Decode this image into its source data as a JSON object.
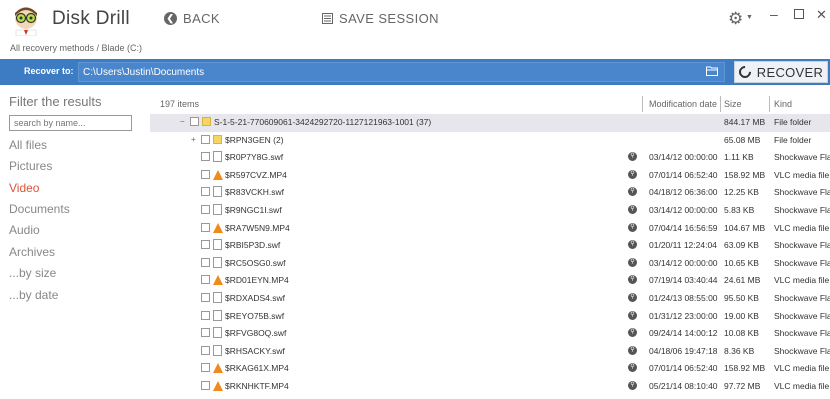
{
  "app": {
    "title": "Disk Drill",
    "back_label": "BACK",
    "save_label": "SAVE SESSION",
    "breadcrumb": "All recovery methods / Blade (C:)"
  },
  "recover": {
    "label": "Recover to:",
    "path": "C:\\Users\\Justin\\Documents",
    "button_label": "RECOVER"
  },
  "sidebar": {
    "title": "Filter the results",
    "search_placeholder": "search by name...",
    "items": [
      {
        "label": "All files"
      },
      {
        "label": "Pictures"
      },
      {
        "label": "Video"
      },
      {
        "label": "Documents"
      },
      {
        "label": "Audio"
      },
      {
        "label": "Archives"
      },
      {
        "label": "...by size"
      },
      {
        "label": "...by date"
      }
    ],
    "active_item": "Video"
  },
  "table": {
    "items_count": "197 items",
    "columns": {
      "date": "Modification date",
      "size": "Size",
      "kind": "Kind"
    },
    "rows": [
      {
        "name": "S-1-5-21-770609061-3424292720-1127121963-1001 (37)",
        "date": "",
        "size": "844.17 MB",
        "kind": "File folder",
        "type": "folder",
        "level": 0,
        "expander": "−",
        "selected": true
      },
      {
        "name": "$RPN3GEN (2)",
        "date": "",
        "size": "65.08 MB",
        "kind": "File folder",
        "type": "folder",
        "level": 1,
        "expander": "+"
      },
      {
        "name": "$R0P7Y8G.swf",
        "date": "03/14/12 00:00:00",
        "size": "1.11 KB",
        "kind": "Shockwave Fla",
        "type": "doc",
        "level": 1
      },
      {
        "name": "$R597CVZ.MP4",
        "date": "07/01/14 06:52:40",
        "size": "158.92 MB",
        "kind": "VLC media file",
        "type": "vlc",
        "level": 1
      },
      {
        "name": "$R83VCKH.swf",
        "date": "04/18/12 06:36:00",
        "size": "12.25 KB",
        "kind": "Shockwave Fla",
        "type": "doc",
        "level": 1
      },
      {
        "name": "$R9NGC1I.swf",
        "date": "03/14/12 00:00:00",
        "size": "5.83 KB",
        "kind": "Shockwave Fla",
        "type": "doc",
        "level": 1
      },
      {
        "name": "$RA7W5N9.MP4",
        "date": "07/04/14 16:56:59",
        "size": "104.67 MB",
        "kind": "VLC media file",
        "type": "vlc",
        "level": 1
      },
      {
        "name": "$RBI5P3D.swf",
        "date": "01/20/11 12:24:04",
        "size": "63.09 KB",
        "kind": "Shockwave Fla",
        "type": "doc",
        "level": 1
      },
      {
        "name": "$RC5OSG0.swf",
        "date": "03/14/12 00:00:00",
        "size": "10.65 KB",
        "kind": "Shockwave Fla",
        "type": "doc",
        "level": 1
      },
      {
        "name": "$RD01EYN.MP4",
        "date": "07/19/14 03:40:44",
        "size": "24.61 MB",
        "kind": "VLC media file",
        "type": "vlc",
        "level": 1
      },
      {
        "name": "$RDXADS4.swf",
        "date": "01/24/13 08:55:00",
        "size": "95.50 KB",
        "kind": "Shockwave Fla",
        "type": "doc",
        "level": 1
      },
      {
        "name": "$REYO75B.swf",
        "date": "01/31/12 23:00:00",
        "size": "19.00 KB",
        "kind": "Shockwave Fla",
        "type": "doc",
        "level": 1
      },
      {
        "name": "$RFVG8OQ.swf",
        "date": "09/24/14 14:00:12",
        "size": "10.08 KB",
        "kind": "Shockwave Fla",
        "type": "doc",
        "level": 1
      },
      {
        "name": "$RHSACKY.swf",
        "date": "04/18/06 19:47:18",
        "size": "8.36 KB",
        "kind": "Shockwave Fla",
        "type": "doc",
        "level": 1
      },
      {
        "name": "$RKAG61X.MP4",
        "date": "07/01/14 06:52:40",
        "size": "158.92 MB",
        "kind": "VLC media file",
        "type": "vlc",
        "level": 1
      },
      {
        "name": "$RKNHKTF.MP4",
        "date": "05/21/14 08:10:40",
        "size": "97.72 MB",
        "kind": "VLC media file",
        "type": "vlc",
        "level": 1
      }
    ]
  },
  "colors": {
    "recover_bar": "#3d7bc2",
    "active_filter": "#e0533c",
    "selected_row": "#e6e6ec"
  }
}
